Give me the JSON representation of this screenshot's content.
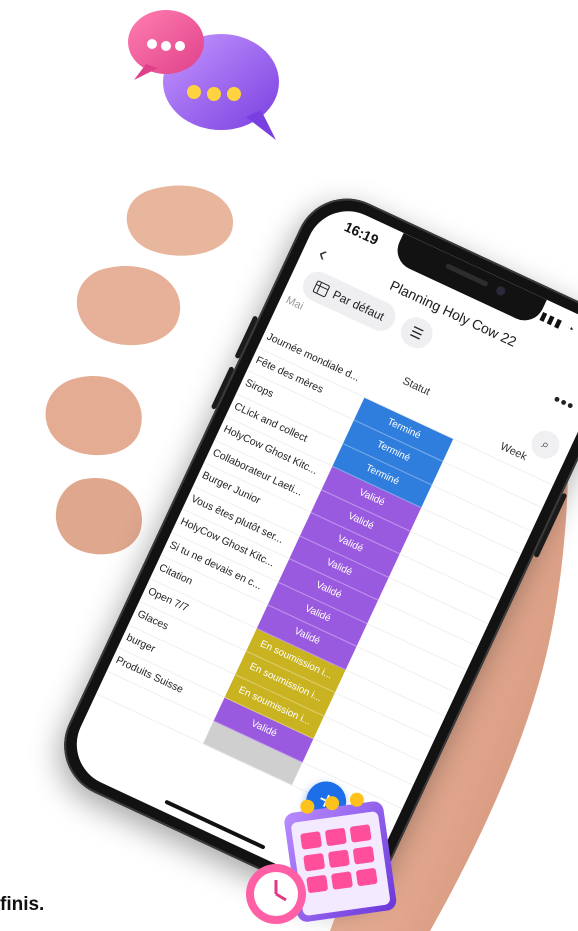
{
  "caption": "finis.",
  "phone": {
    "time": "16:19",
    "title": "Planning Holy Cow 22",
    "view_label": "Par défaut",
    "month_label": "Mai",
    "column_statut": "Statut",
    "column_week": "Week",
    "rows": [
      {
        "name": "Journée mondiale d...",
        "status": "",
        "color": ""
      },
      {
        "name": "Fête des mères",
        "status": "Terminé",
        "color": "#2f7ddc"
      },
      {
        "name": "Sirops",
        "status": "Terminé",
        "color": "#2f7ddc"
      },
      {
        "name": "CLick and collect",
        "status": "Terminé",
        "color": "#2f7ddc"
      },
      {
        "name": "HolyCow Ghost Kitc...",
        "status": "Validé",
        "color": "#9a5ae0"
      },
      {
        "name": "Collaborateur  Laeti...",
        "status": "Validé",
        "color": "#9a5ae0"
      },
      {
        "name": "Burger Junior",
        "status": "Validé",
        "color": "#9a5ae0"
      },
      {
        "name": "Vous êtes plutôt ser...",
        "status": "Validé",
        "color": "#9a5ae0"
      },
      {
        "name": "HolyCow Ghost Kitc...",
        "status": "Validé",
        "color": "#9a5ae0"
      },
      {
        "name": "Si tu ne devais en c...",
        "status": "Validé",
        "color": "#9a5ae0"
      },
      {
        "name": "Citation",
        "status": "Validé",
        "color": "#9a5ae0"
      },
      {
        "name": "Open 7/7",
        "status": "En soumission i...",
        "color": "#c9b320"
      },
      {
        "name": "Glaces",
        "status": "En soumission i...",
        "color": "#c9b320"
      },
      {
        "name": "burger",
        "status": "En soumission i...",
        "color": "#c9b320"
      },
      {
        "name": "Produits Suisse",
        "status": "Validé",
        "color": "#9a5ae0"
      },
      {
        "name": "",
        "status": "",
        "color": "#cfcfcf"
      }
    ]
  }
}
